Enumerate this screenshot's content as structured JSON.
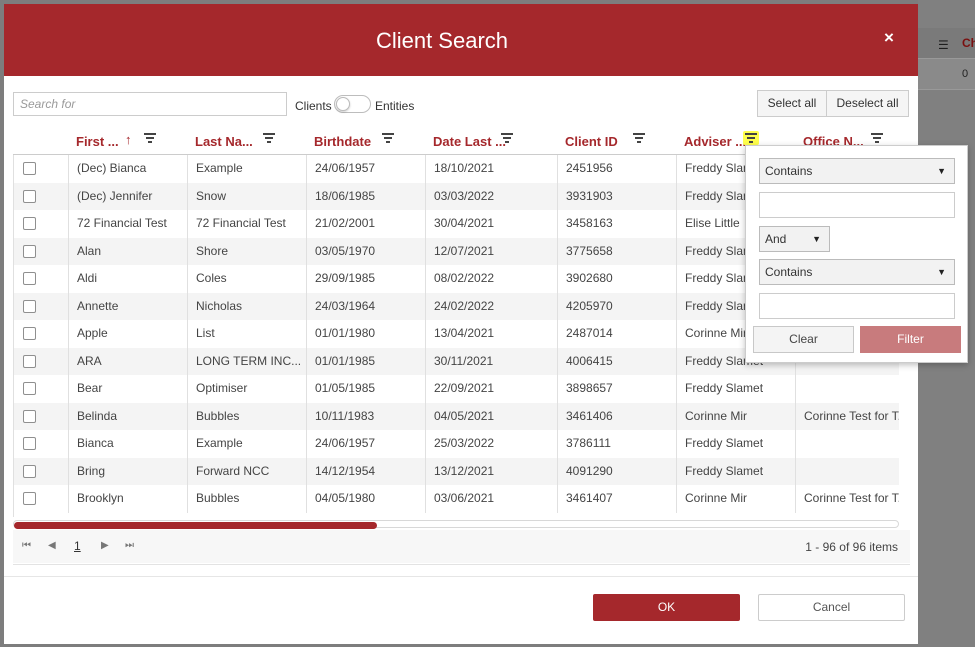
{
  "background": {
    "column_header": "Ch",
    "first_cell": "0"
  },
  "modal": {
    "title": "Client Search",
    "close_label": "×"
  },
  "search": {
    "placeholder": "Search for",
    "value": ""
  },
  "toggle": {
    "left_label": "Clients",
    "right_label": "Entities",
    "state": "Clients"
  },
  "buttons": {
    "select_all": "Select all",
    "deselect_all": "Deselect all",
    "ok": "OK",
    "cancel": "Cancel"
  },
  "columns": [
    {
      "label": "First ...",
      "sorted": "ascending",
      "sort_icon": "↑"
    },
    {
      "label": "Last Na..."
    },
    {
      "label": "Birthdate"
    },
    {
      "label": "Date Last ..."
    },
    {
      "label": "Client ID"
    },
    {
      "label": "Adviser ...",
      "filter_highlighted": true
    },
    {
      "label": "Office N..."
    }
  ],
  "rows": [
    [
      "(Dec) Bianca",
      "Example",
      "24/06/1957",
      "18/10/2021",
      "2451956",
      "Freddy Slamet",
      ""
    ],
    [
      "(Dec) Jennifer",
      "Snow",
      "18/06/1985",
      "03/03/2022",
      "3931903",
      "Freddy Slamet",
      ""
    ],
    [
      "72 Financial Test",
      "72 Financial Test",
      "21/02/2001",
      "30/04/2021",
      "3458163",
      "Elise Little",
      ""
    ],
    [
      "Alan",
      "Shore",
      "03/05/1970",
      "12/07/2021",
      "3775658",
      "Freddy Slamet",
      ""
    ],
    [
      "Aldi",
      "Coles",
      "29/09/1985",
      "08/02/2022",
      "3902680",
      "Freddy Slamet",
      ""
    ],
    [
      "Annette",
      "Nicholas",
      "24/03/1964",
      "24/02/2022",
      "4205970",
      "Freddy Slamet",
      ""
    ],
    [
      "Apple",
      "List",
      "01/01/1980",
      "13/04/2021",
      "2487014",
      "Corinne Mir",
      ""
    ],
    [
      "ARA",
      "LONG TERM INC...",
      "01/01/1985",
      "30/11/2021",
      "4006415",
      "Freddy Slamet",
      ""
    ],
    [
      "Bear",
      "Optimiser",
      "01/05/1985",
      "22/09/2021",
      "3898657",
      "Freddy Slamet",
      ""
    ],
    [
      "Belinda",
      "Bubbles",
      "10/11/1983",
      "04/05/2021",
      "3461406",
      "Corinne Mir",
      "Corinne Test for T..."
    ],
    [
      "Bianca",
      "Example",
      "24/06/1957",
      "25/03/2022",
      "3786111",
      "Freddy Slamet",
      ""
    ],
    [
      "Bring",
      "Forward NCC",
      "14/12/1954",
      "13/12/2021",
      "4091290",
      "Freddy Slamet",
      ""
    ],
    [
      "Brooklyn",
      "Bubbles",
      "04/05/1980",
      "03/06/2021",
      "3461407",
      "Corinne Mir",
      "Corinne Test for T..."
    ]
  ],
  "pager": {
    "first": "⏮",
    "prev": "◀",
    "page": "1",
    "next": "▶",
    "last": "⏭",
    "info": "1 - 96 of 96 items"
  },
  "scroll_position": 0.41,
  "filter_popup": {
    "operator1": "Contains",
    "value1": "",
    "logic": "And",
    "operator2": "Contains",
    "value2": "",
    "clear_label": "Clear",
    "filter_label": "Filter"
  },
  "colors": {
    "brand": "#a5282c",
    "highlight": "#ffff4d",
    "filter_button": "#c87b7d"
  }
}
